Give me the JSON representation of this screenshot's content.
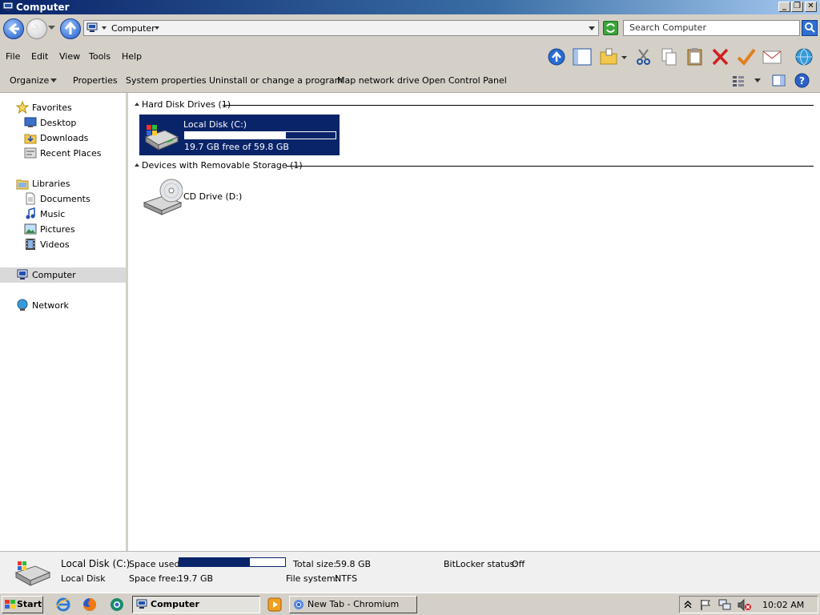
{
  "window": {
    "title": "Computer",
    "controls": {
      "minimize": "_",
      "restore": "❐",
      "close": "✕"
    }
  },
  "address": {
    "path_item": "Computer",
    "search_placeholder": "Search Computer"
  },
  "menu": [
    "File",
    "Edit",
    "View",
    "Tools",
    "Help"
  ],
  "toolbar_icons": [
    "up-icon",
    "view-pane-icon",
    "folder-icon",
    "cut-icon",
    "copy-icon",
    "paste-icon",
    "delete-icon",
    "check-icon",
    "mail-icon",
    "globe-icon"
  ],
  "commands": {
    "organize": "Organize",
    "properties": "Properties",
    "system_properties": "System properties",
    "uninstall": "Uninstall or change a program",
    "map_drive": "Map network drive",
    "control_panel": "Open Control Panel"
  },
  "nav": {
    "favorites": "Favorites",
    "desktop": "Desktop",
    "downloads": "Downloads",
    "recent": "Recent Places",
    "libraries": "Libraries",
    "documents": "Documents",
    "music": "Music",
    "pictures": "Pictures",
    "videos": "Videos",
    "computer": "Computer",
    "network": "Network"
  },
  "groups": {
    "hdd": {
      "header": "Hard Disk Drives (1)",
      "drive_name": "Local Disk (C:)",
      "drive_space": "19.7 GB free of 59.8 GB",
      "used_fraction": 0.67
    },
    "removable": {
      "header": "Devices with Removable Storage (1)",
      "drive_name": "CD Drive (D:)"
    }
  },
  "details": {
    "name": "Local Disk (C:)",
    "type": "Local Disk",
    "space_used_label": "Space used:",
    "space_free_label": "Space free:",
    "space_free_value": "19.7 GB",
    "total_size_label": "Total size:",
    "total_size_value": "59.8 GB",
    "file_system_label": "File system:",
    "file_system_value": "NTFS",
    "bitlocker_label": "BitLocker status:",
    "bitlocker_value": "Off",
    "used_fraction": 0.67
  },
  "taskbar": {
    "start": "Start",
    "task_computer": "Computer",
    "task_chromium": "New Tab - Chromium",
    "clock": "10:02 AM"
  },
  "colors": {
    "selection": "#0a246a",
    "titlebar_start": "#0a246a",
    "face": "#d4d0c8"
  }
}
